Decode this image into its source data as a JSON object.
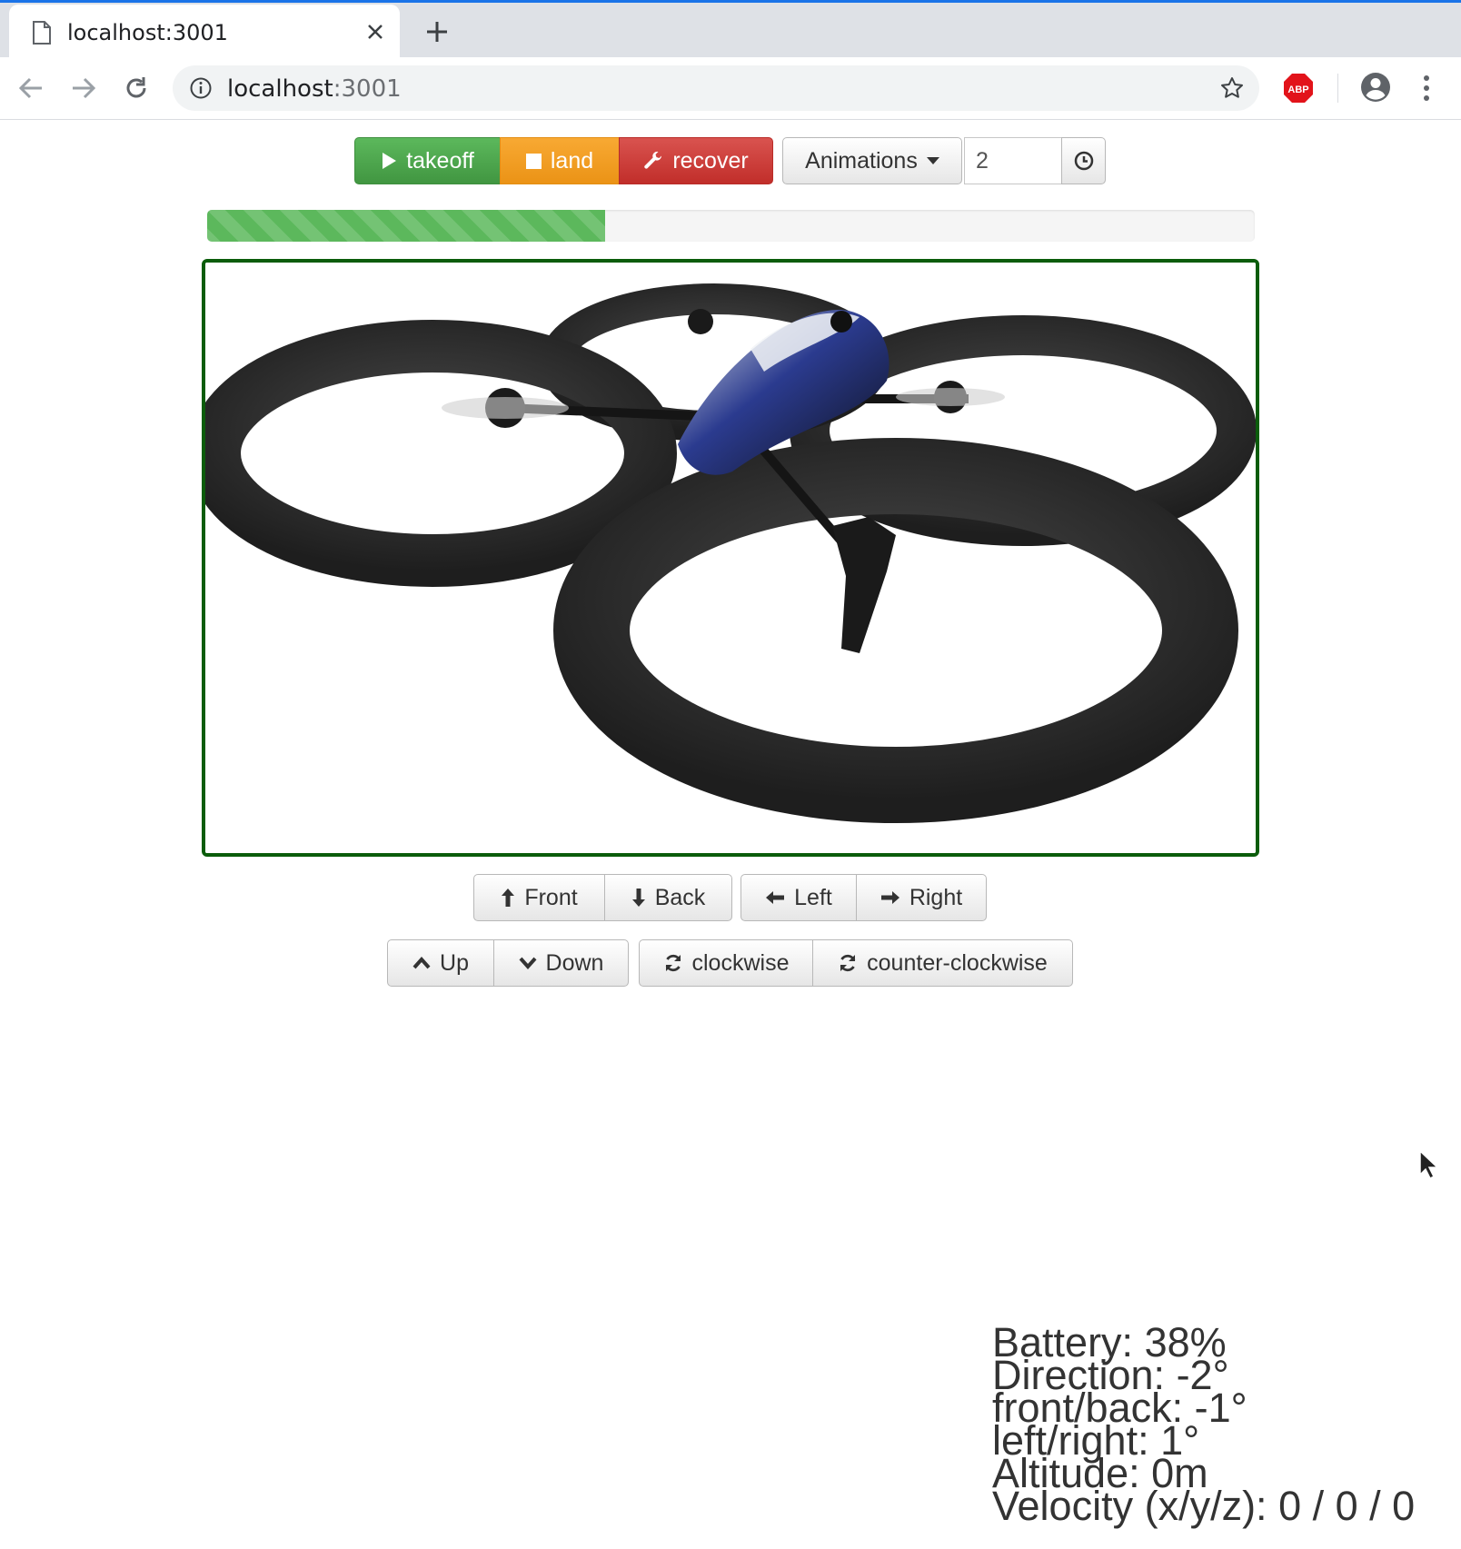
{
  "browser": {
    "tab_title": "localhost:3001",
    "url_host": "localhost",
    "url_port": ":3001"
  },
  "controls": {
    "takeoff_label": "takeoff",
    "land_label": "land",
    "recover_label": "recover",
    "animations_label": "Animations",
    "animation_repeat_value": "2"
  },
  "battery_bar": {
    "fraction": 0.38,
    "color": "#5cb85c"
  },
  "movement": {
    "front_label": "Front",
    "back_label": "Back",
    "left_label": "Left",
    "right_label": "Right",
    "up_label": "Up",
    "down_label": "Down",
    "clockwise_label": "clockwise",
    "counter_clockwise_label": "counter-clockwise"
  },
  "telemetry": {
    "battery": "Battery: 38%",
    "direction": "Direction: -2°",
    "front_back": "front/back: -1°",
    "left_right": "left/right: 1°",
    "altitude": "Altitude: 0m",
    "velocity": "Velocity (x/y/z): 0 / 0 / 0"
  },
  "colors": {
    "takeoff": "#5cb85c",
    "land": "#f0ad4e",
    "recover": "#d9534f",
    "video_border": "#0b5c0b",
    "chrome_accent": "#1a73e8"
  }
}
